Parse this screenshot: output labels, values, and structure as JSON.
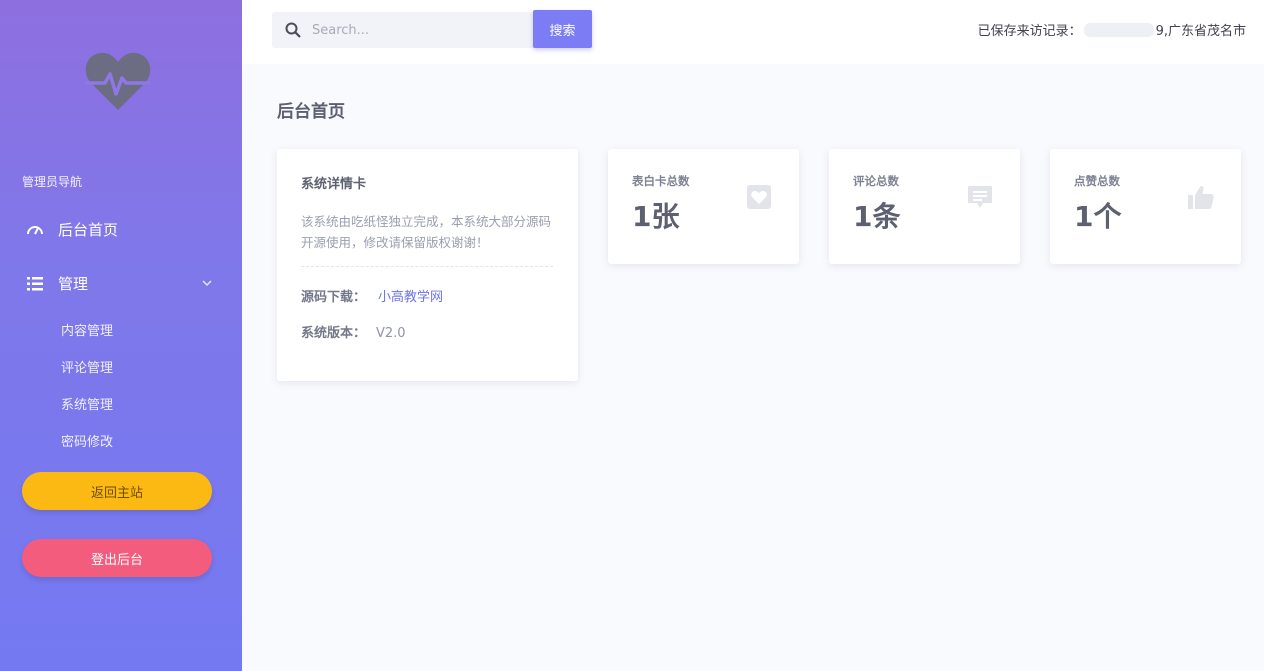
{
  "sidebar": {
    "nav_title": "管理员导航",
    "home_label": "后台首页",
    "manage_label": "管理",
    "sub_items": [
      "内容管理",
      "评论管理",
      "系统管理",
      "密码修改"
    ],
    "back_button": "返回主站",
    "logout_button": "登出后台"
  },
  "topbar": {
    "search_placeholder": "Search...",
    "search_button": "搜索",
    "visit_prefix": "已保存来访记录：",
    "visit_suffix": "9,广东省茂名市"
  },
  "main": {
    "page_title": "后台首页",
    "info_card": {
      "title": "系统详情卡",
      "description": "该系统由吃纸怪独立完成，本系统大部分源码开源使用，修改请保留版权谢谢！",
      "source_label": "源码下载：",
      "source_link": "小高教学网",
      "version_label": "系统版本：",
      "version_value": "V2.0"
    },
    "stats": [
      {
        "label": "表白卡总数",
        "value": "1张",
        "icon": "heart-card-icon"
      },
      {
        "label": "评论总数",
        "value": "1条",
        "icon": "comment-icon"
      },
      {
        "label": "点赞总数",
        "value": "1个",
        "icon": "thumbs-up-icon"
      }
    ]
  },
  "colors": {
    "sidebar_top": "#8e6fe0",
    "sidebar_bottom": "#7479f2",
    "accent": "#7c7cf4",
    "back_button": "#fdb913",
    "logout_button": "#f45c7d"
  }
}
